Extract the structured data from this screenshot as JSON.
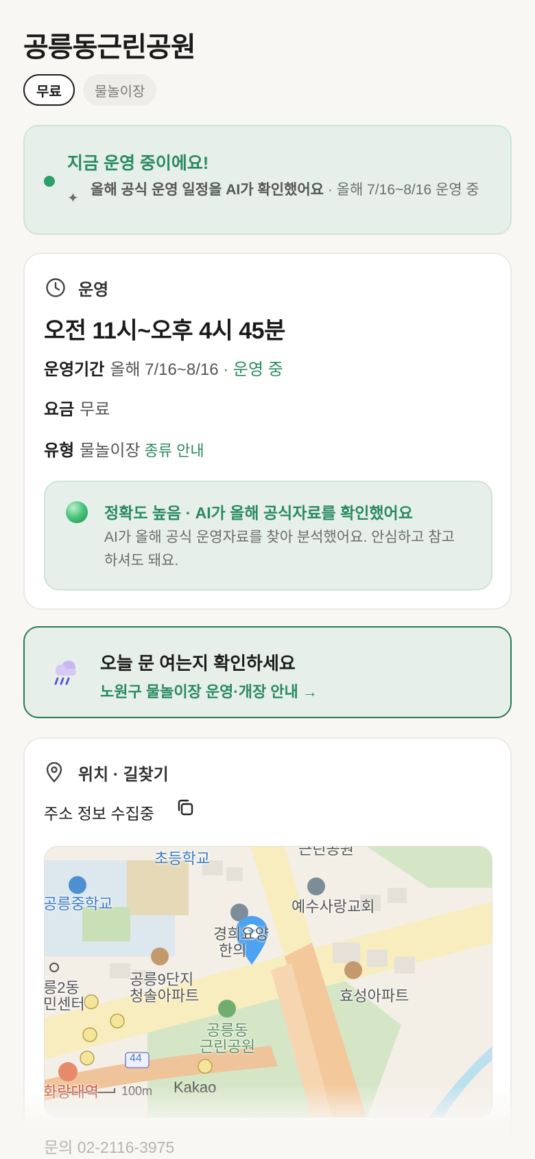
{
  "title": "공릉동근린공원",
  "tags": [
    {
      "label": "무료",
      "active": true
    },
    {
      "label": "물놀이장",
      "active": false
    }
  ],
  "status": {
    "title": "지금 운영 중이에요!",
    "sub_bold": "올해 공식 운영 일정을 AI가 확인했어요",
    "sub_rest": " · 올해 7/16~8/16 운영 중"
  },
  "operation": {
    "section_label": "운영",
    "hours": "오전 11시~오후 4시 45분",
    "period_key": "운영기간",
    "period_value": "올해 7/16~8/16",
    "period_status": " · 운영 중",
    "fee_key": "요금",
    "fee_value": "무료",
    "type_key": "유형",
    "type_value": "물놀이장",
    "type_link": "종류 안내",
    "accuracy_title": "정확도 높음 · AI가 올해 공식자료를 확인했어요",
    "accuracy_text": "AI가 올해 공식 운영자료를 찾아 분석했어요. 안심하고 참고하셔도 돼요."
  },
  "check": {
    "title": "오늘 문 여는지 확인하세요",
    "link": "노원구 물놀이장 운영·개장 안내 →"
  },
  "location": {
    "section_label": "위치 · 길찾기",
    "address": "주소 정보 수집중",
    "map_labels": {
      "school_elem": "초등학교",
      "school_mid": "공릉중학교",
      "church": "예수사랑교회",
      "hospital": "경희요양",
      "hospital2": "한의",
      "apt1_a": "공릉9단지",
      "apt1_b": "청솔아파트",
      "apt2": "효성아파트",
      "center_a": "릉2동",
      "center_b": "민센터",
      "park_a": "공릉동",
      "park_b": "근린공원",
      "road": "44",
      "station": "화랑대역",
      "scale": "100m",
      "kakao": "Kakao",
      "park_top": "근린공원"
    }
  },
  "contact": "문의 02-2116-3975",
  "colors": {
    "accent": "#2a8a5e",
    "status_bg": "#e6efea",
    "page_bg": "#f8f7f4"
  }
}
